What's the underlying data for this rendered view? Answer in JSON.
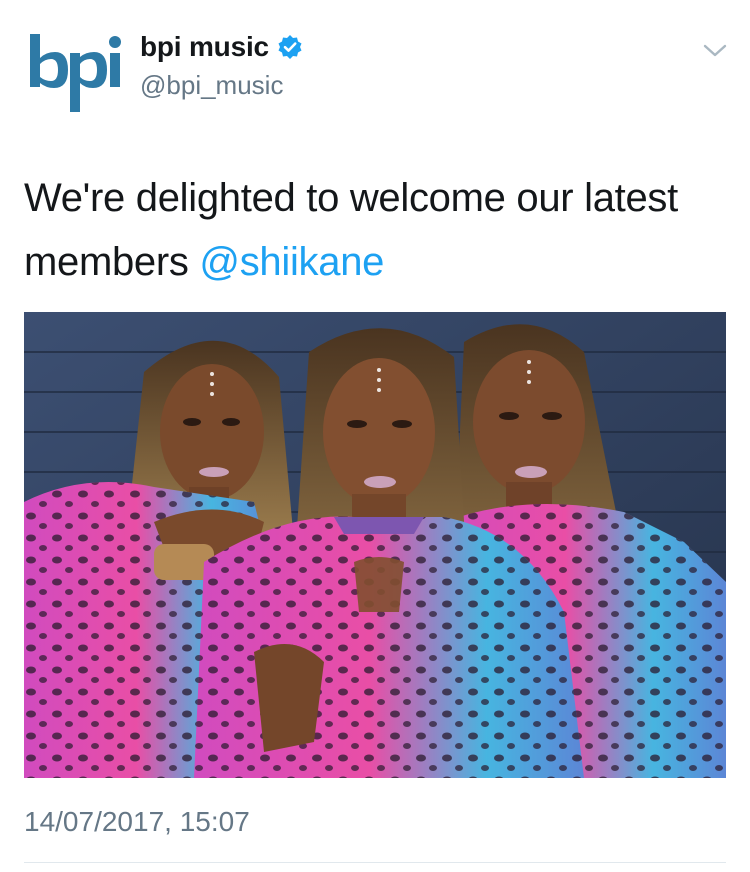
{
  "tweet": {
    "author": {
      "display_name": "bpi music",
      "handle": "@bpi_music",
      "logo_text": "bpi",
      "verified": true,
      "verified_icon": "verified-badge-icon"
    },
    "menu_icon": "chevron-down-icon",
    "text_main": "We're delighted to welcome our latest members ",
    "mention": "@shiikane",
    "media": {
      "alt_subject": "photo"
    },
    "timestamp": "14/07/2017, 15:07"
  },
  "colors": {
    "text": "#14171a",
    "secondary": "#657786",
    "link": "#1da1f2",
    "verified": "#1da1f2",
    "logo": "#2e7aa6"
  }
}
